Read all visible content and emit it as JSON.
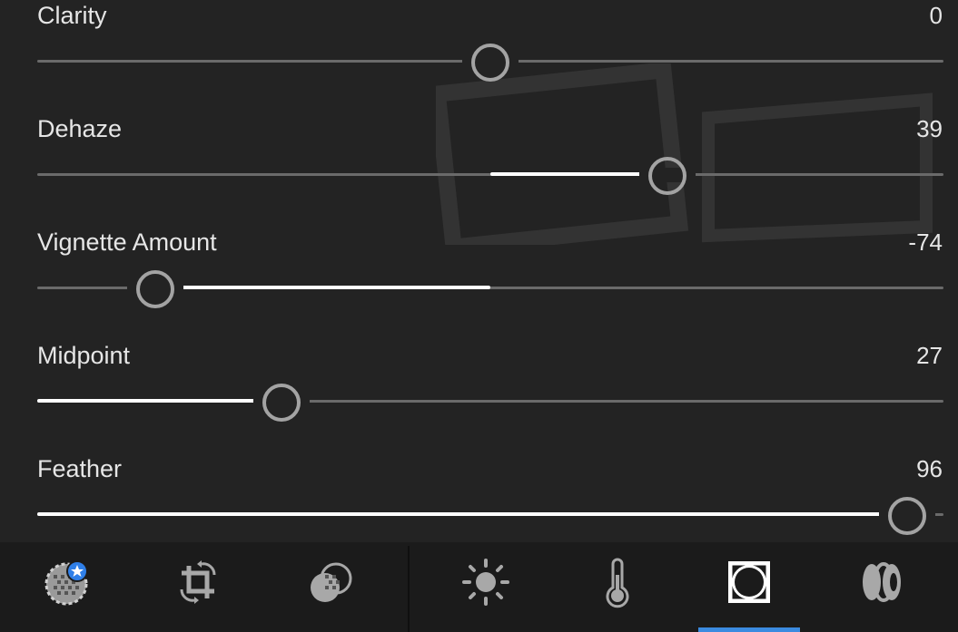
{
  "sliders": [
    {
      "label": "Clarity",
      "value": "0",
      "min": -100,
      "max": 100,
      "numeric": 0
    },
    {
      "label": "Dehaze",
      "value": "39",
      "min": -100,
      "max": 100,
      "numeric": 39
    },
    {
      "label": "Vignette Amount",
      "value": "-74",
      "min": -100,
      "max": 100,
      "numeric": -74
    },
    {
      "label": "Midpoint",
      "value": "27",
      "min": 0,
      "max": 100,
      "numeric": 27
    },
    {
      "label": "Feather",
      "value": "96",
      "min": 0,
      "max": 100,
      "numeric": 96
    }
  ],
  "toolbar": {
    "left_tools": [
      {
        "icon": "presets-icon",
        "badge": "star-badge-icon"
      },
      {
        "icon": "crop-rotate-icon"
      },
      {
        "icon": "selective-mask-icon"
      }
    ],
    "right_tools": [
      {
        "icon": "light-icon"
      },
      {
        "icon": "color-temperature-icon"
      },
      {
        "icon": "effects-vignette-icon",
        "active": true
      },
      {
        "icon": "optics-icon"
      }
    ],
    "accent_color": "#3b8be0"
  },
  "colors": {
    "background": "#232323",
    "toolbar_background": "#1b1b1b",
    "text": "#e6e6e6",
    "track": "#6a6a6a",
    "track_fill": "#ffffff",
    "thumb": "#a3a3a3"
  }
}
